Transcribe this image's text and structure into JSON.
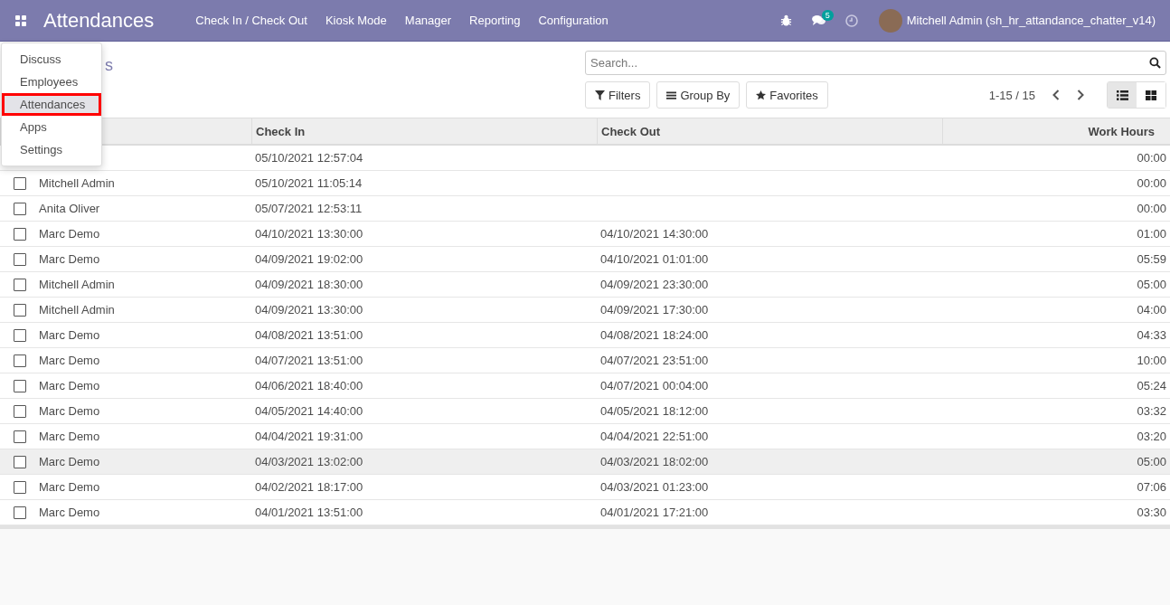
{
  "navbar": {
    "app_title": "Attendances",
    "menu": [
      "Check In / Check Out",
      "Kiosk Mode",
      "Manager",
      "Reporting",
      "Configuration"
    ],
    "messages_badge": "5",
    "user": "Mitchell Admin (sh_hr_attandance_chatter_v14)"
  },
  "apps_menu": {
    "items": [
      {
        "label": "Discuss",
        "selected": false
      },
      {
        "label": "Employees",
        "selected": false
      },
      {
        "label": "Attendances",
        "selected": true
      },
      {
        "label": "Apps",
        "selected": false
      },
      {
        "label": "Settings",
        "selected": false
      }
    ]
  },
  "breadcrumb_fragment": "s",
  "search": {
    "placeholder": "Search..."
  },
  "buttons": [
    "Filters",
    "Group By",
    "Favorites"
  ],
  "pager": "1-15 / 15",
  "views": [
    {
      "kind": "list",
      "selected": true
    },
    {
      "kind": "kanban",
      "selected": false
    }
  ],
  "table": {
    "columns": [
      "Check In",
      "Check Out",
      "Work Hours"
    ],
    "rows": [
      {
        "check_in": "05/10/2021 12:57:04",
        "work_hours": "00:00",
        "hovered": false
      },
      {
        "checked": false,
        "employee": "Mitchell Admin",
        "check_in": "05/10/2021 11:05:14",
        "work_hours": "00:00",
        "hovered": false
      },
      {
        "checked": false,
        "employee": "Anita Oliver",
        "check_in": "05/07/2021 12:53:11",
        "work_hours": "00:00",
        "hovered": false
      },
      {
        "checked": false,
        "employee": "Marc Demo",
        "check_in": "04/10/2021 13:30:00",
        "check_out": "04/10/2021 14:30:00",
        "work_hours": "01:00",
        "hovered": false
      },
      {
        "checked": false,
        "employee": "Marc Demo",
        "check_in": "04/09/2021 19:02:00",
        "check_out": "04/10/2021 01:01:00",
        "work_hours": "05:59",
        "hovered": false
      },
      {
        "checked": false,
        "employee": "Mitchell Admin",
        "check_in": "04/09/2021 18:30:00",
        "check_out": "04/09/2021 23:30:00",
        "work_hours": "05:00",
        "hovered": false
      },
      {
        "checked": false,
        "employee": "Mitchell Admin",
        "check_in": "04/09/2021 13:30:00",
        "check_out": "04/09/2021 17:30:00",
        "work_hours": "04:00",
        "hovered": false
      },
      {
        "checked": false,
        "employee": "Marc Demo",
        "check_in": "04/08/2021 13:51:00",
        "check_out": "04/08/2021 18:24:00",
        "work_hours": "04:33",
        "hovered": false
      },
      {
        "checked": false,
        "employee": "Marc Demo",
        "check_in": "04/07/2021 13:51:00",
        "check_out": "04/07/2021 23:51:00",
        "work_hours": "10:00",
        "hovered": false
      },
      {
        "checked": false,
        "employee": "Marc Demo",
        "check_in": "04/06/2021 18:40:00",
        "check_out": "04/07/2021 00:04:00",
        "work_hours": "05:24",
        "hovered": false
      },
      {
        "checked": false,
        "employee": "Marc Demo",
        "check_in": "04/05/2021 14:40:00",
        "check_out": "04/05/2021 18:12:00",
        "work_hours": "03:32",
        "hovered": false
      },
      {
        "checked": false,
        "employee": "Marc Demo",
        "check_in": "04/04/2021 19:31:00",
        "check_out": "04/04/2021 22:51:00",
        "work_hours": "03:20",
        "hovered": false
      },
      {
        "checked": false,
        "employee": "Marc Demo",
        "check_in": "04/03/2021 13:02:00",
        "check_out": "04/03/2021 18:02:00",
        "work_hours": "05:00",
        "hovered": true
      },
      {
        "checked": false,
        "employee": "Marc Demo",
        "check_in": "04/02/2021 18:17:00",
        "check_out": "04/03/2021 01:23:00",
        "work_hours": "07:06",
        "hovered": false
      },
      {
        "checked": false,
        "employee": "Marc Demo",
        "check_in": "04/01/2021 13:51:00",
        "check_out": "04/01/2021 17:21:00",
        "work_hours": "03:30",
        "hovered": false
      }
    ]
  }
}
